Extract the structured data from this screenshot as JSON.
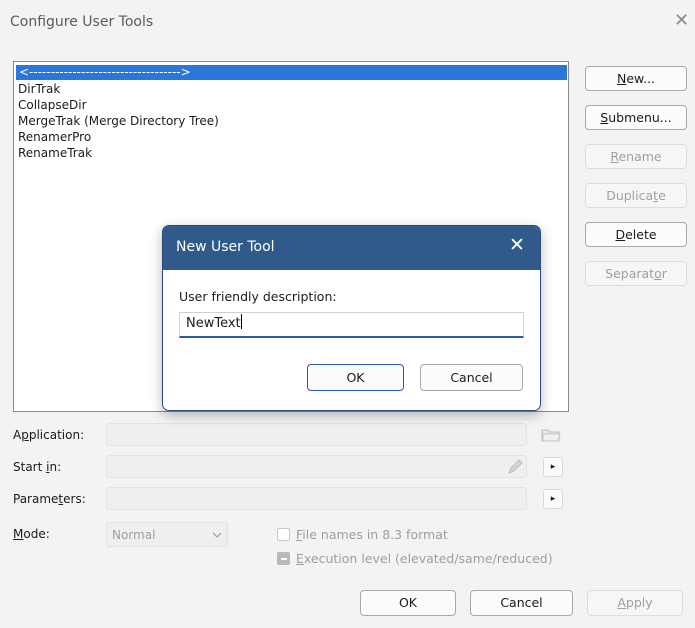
{
  "window": {
    "title": "Configure User Tools",
    "close_glyph": "✕"
  },
  "tools_list": [
    "<----------------------------------->",
    "DirTrak",
    "CollapseDir",
    "MergeTrak (Merge Directory Tree)",
    "RenamerPro",
    "RenameTrak"
  ],
  "side_buttons": {
    "new": {
      "label": "New...",
      "accel": "N",
      "rest": "ew..."
    },
    "submenu": {
      "label": "Submenu...",
      "accel": "S",
      "rest": "ubmenu..."
    },
    "rename": {
      "label": "Rename",
      "pre": "",
      "accel": "R",
      "rest": "ename"
    },
    "duplicate": {
      "label": "Duplicate",
      "pre": "Duplica",
      "accel": "t",
      "rest": "e"
    },
    "delete": {
      "label": "Delete",
      "accel": "D",
      "rest": "elete"
    },
    "separator": {
      "label": "Separator",
      "pre": "Separat",
      "accel": "o",
      "rest": "r"
    }
  },
  "fields": {
    "application": {
      "pre": "A",
      "accel": "p",
      "rest": "plication:",
      "value": ""
    },
    "start_in": {
      "pre": "Start ",
      "accel": "i",
      "rest": "n:",
      "value": ""
    },
    "parameters": {
      "pre": "Parame",
      "accel": "t",
      "rest": "ers:",
      "value": ""
    },
    "mode": {
      "pre": "",
      "accel": "M",
      "rest": "ode:",
      "value": "Normal"
    }
  },
  "checkboxes": {
    "file_names": {
      "accel": "F",
      "rest": "ile names in 8.3 format",
      "state": "unchecked"
    },
    "execution": {
      "accel": "E",
      "rest": "xecution level (elevated/same/reduced)",
      "state": "indeterminate"
    }
  },
  "footer": {
    "ok": "OK",
    "cancel": "Cancel",
    "apply_accel": "A",
    "apply_rest": "pply"
  },
  "modal": {
    "title": "New User Tool",
    "close_glyph": "✕",
    "label": "User friendly description:",
    "input_value": "NewText",
    "ok": "OK",
    "cancel": "Cancel"
  },
  "icons": {
    "browse": "folder-icon",
    "edit": "pencil-icon",
    "arrow": "▸",
    "dropdown": "chevron-down-icon"
  }
}
